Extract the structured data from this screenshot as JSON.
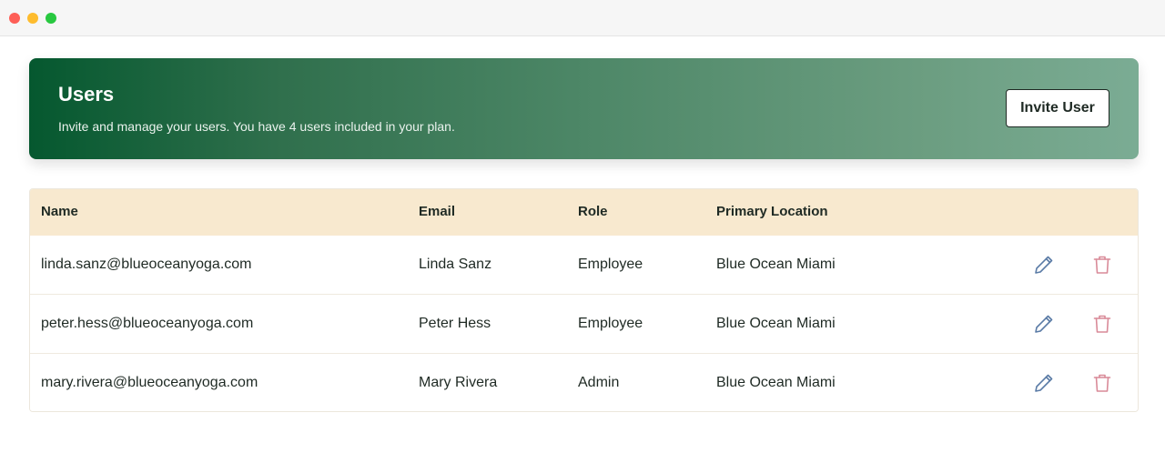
{
  "window": {
    "controls": [
      "close",
      "minimize",
      "maximize"
    ]
  },
  "header": {
    "title": "Users",
    "subtitle": "Invite and manage your users. You have 4 users included in your plan.",
    "invite_button": "Invite User"
  },
  "table": {
    "columns": [
      "Name",
      "Email",
      "Role",
      "Primary Location"
    ],
    "rows": [
      {
        "name": "linda.sanz@blueoceanyoga.com",
        "email": "Linda Sanz",
        "role": "Employee",
        "location": "Blue Ocean Miami"
      },
      {
        "name": "peter.hess@blueoceanyoga.com",
        "email": "Peter Hess",
        "role": "Employee",
        "location": "Blue Ocean Miami"
      },
      {
        "name": "mary.rivera@blueoceanyoga.com",
        "email": "Mary Rivera",
        "role": "Admin",
        "location": "Blue Ocean Miami"
      }
    ],
    "row_actions": {
      "edit_icon": "pencil-icon",
      "delete_icon": "trash-icon"
    }
  },
  "colors": {
    "banner_start": "#05582f",
    "banner_end": "#7bac94",
    "header_row": "#f8e9cf",
    "edit_icon": "#5a7ba6",
    "delete_icon": "#d98a98"
  }
}
